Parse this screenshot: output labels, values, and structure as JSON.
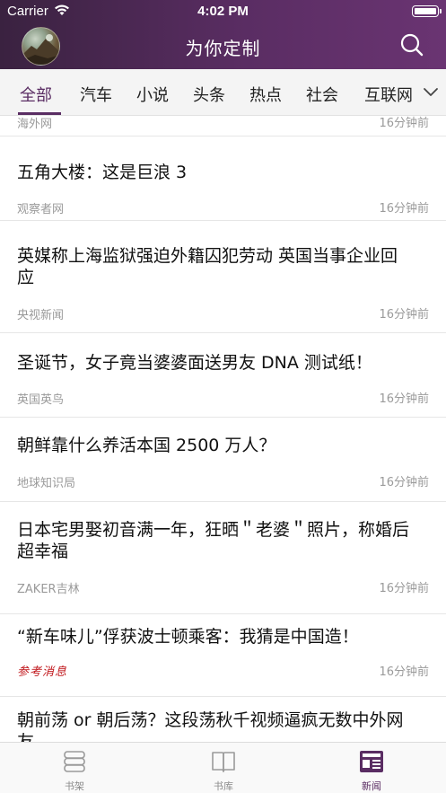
{
  "status_bar": {
    "carrier": "Carrier",
    "time": "4:02 PM"
  },
  "nav": {
    "title": "为你定制",
    "avatar_icon": "user-avatar",
    "search_icon": "search-icon"
  },
  "tabs": {
    "items": [
      {
        "label": "全部",
        "active": true
      },
      {
        "label": "汽车",
        "active": false
      },
      {
        "label": "小说",
        "active": false
      },
      {
        "label": "头条",
        "active": false
      },
      {
        "label": "热点",
        "active": false
      },
      {
        "label": "社会",
        "active": false
      },
      {
        "label": "互联网",
        "active": false
      }
    ],
    "more_icon": "chevron-down-icon",
    "accent_color": "#5a2d63"
  },
  "feed": {
    "items": [
      {
        "title": "",
        "source": "海外网",
        "time": "16分钟前"
      },
      {
        "title": "五角大楼：这是巨浪 3",
        "source": "观察者网",
        "time": "16分钟前"
      },
      {
        "title": "英媒称上海监狱强迫外籍囚犯劳动 英国当事企业回应",
        "source": "央视新闻",
        "time": "16分钟前"
      },
      {
        "title": "圣诞节，女子竟当婆婆面送男友 DNA 测试纸！",
        "source": "英国英鸟",
        "time": "16分钟前"
      },
      {
        "title": "朝鲜靠什么养活本国 2500 万人？",
        "source": "地球知识局",
        "time": "16分钟前"
      },
      {
        "title": "日本宅男娶初音满一年，狂晒＂老婆＂照片，称婚后超幸福",
        "source": "ZAKER吉林",
        "time": "16分钟前"
      },
      {
        "title": "“新车味儿”俘获波士顿乘客：我猜是中国造！",
        "source": "参考消息",
        "time": "16分钟前"
      },
      {
        "title": "朝前荡 or 朝后荡？这段荡秋千视频逼疯无数中外网友",
        "source": "",
        "time": ""
      }
    ]
  },
  "tabbar": {
    "items": [
      {
        "label": "书架",
        "icon": "bookshelf-icon",
        "active": false
      },
      {
        "label": "书库",
        "icon": "open-book-icon",
        "active": false
      },
      {
        "label": "新闻",
        "icon": "newspaper-icon",
        "active": true
      }
    ]
  },
  "colors": {
    "header_start": "#3a2240",
    "header_end": "#6a3472",
    "accent": "#5a2d63"
  }
}
